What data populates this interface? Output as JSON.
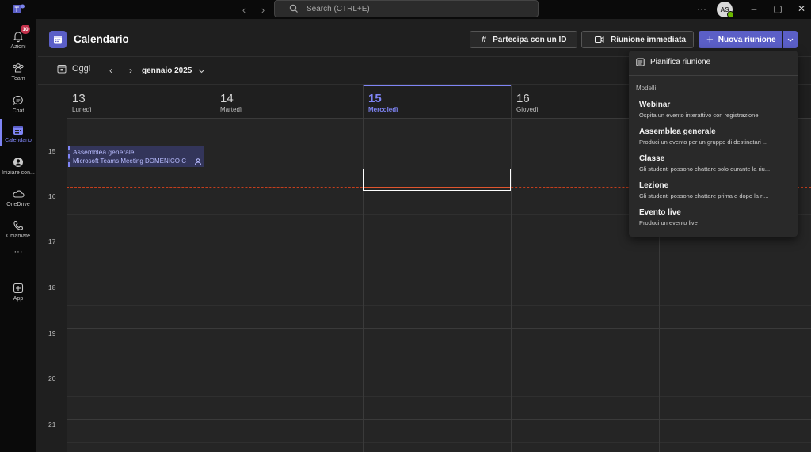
{
  "titlebar": {
    "search_placeholder": "Search (CTRL+E)",
    "more": "···",
    "avatar_initials": "AS",
    "minimize": "–",
    "maximize": "▢",
    "close": "✕"
  },
  "rail": {
    "items": [
      {
        "label": "Azioni",
        "icon": "bell-icon",
        "badge": "10"
      },
      {
        "label": "Team",
        "icon": "team-icon"
      },
      {
        "label": "Chat",
        "icon": "chat-icon"
      },
      {
        "label": "Calendario",
        "icon": "calendar-icon",
        "active": true
      },
      {
        "label": "Iniziare con...",
        "icon": "start-icon"
      },
      {
        "label": "OneDrive",
        "icon": "onedrive-icon"
      },
      {
        "label": "Chiamate",
        "icon": "phone-icon"
      },
      {
        "label": "···",
        "icon": "more-icon"
      },
      {
        "label": "App",
        "icon": "apps-icon"
      }
    ]
  },
  "header": {
    "title": "Calendario",
    "join_id": "Partecipa con un ID",
    "meet_now": "Riunione immediata",
    "new_meeting": "Nuova riunione"
  },
  "toolbar": {
    "today": "Oggi",
    "month": "gennaio 2025"
  },
  "days": [
    {
      "num": "13",
      "name": "Lunedì",
      "today": false
    },
    {
      "num": "14",
      "name": "Martedì",
      "today": false
    },
    {
      "num": "15",
      "name": "Mercoledì",
      "today": true
    },
    {
      "num": "16",
      "name": "Giovedì",
      "today": false
    }
  ],
  "hours": [
    "15",
    "16",
    "17",
    "18",
    "19",
    "20",
    "21"
  ],
  "event": {
    "title": "Assemblea generale",
    "detail": "Microsoft Teams Meeting  DOMENICO C"
  },
  "menu": {
    "schedule": "Pianifica riunione",
    "section": "Modelli",
    "items": [
      {
        "title": "Webinar",
        "desc": "Ospita un evento interattivo con registrazione"
      },
      {
        "title": "Assemblea generale",
        "desc": "Produci un evento per un gruppo di destinatari ..."
      },
      {
        "title": "Classe",
        "desc": "Gli studenti possono chattare solo durante la riu..."
      },
      {
        "title": "Lezione",
        "desc": "Gli studenti possono chattare prima e dopo la ri..."
      },
      {
        "title": "Evento live",
        "desc": "Produci un evento live"
      }
    ]
  },
  "colors": {
    "accent": "#5b5fc7",
    "accent_light": "#7f85f5",
    "now_line": "#c43e1c",
    "background": "#1f1f1f"
  }
}
